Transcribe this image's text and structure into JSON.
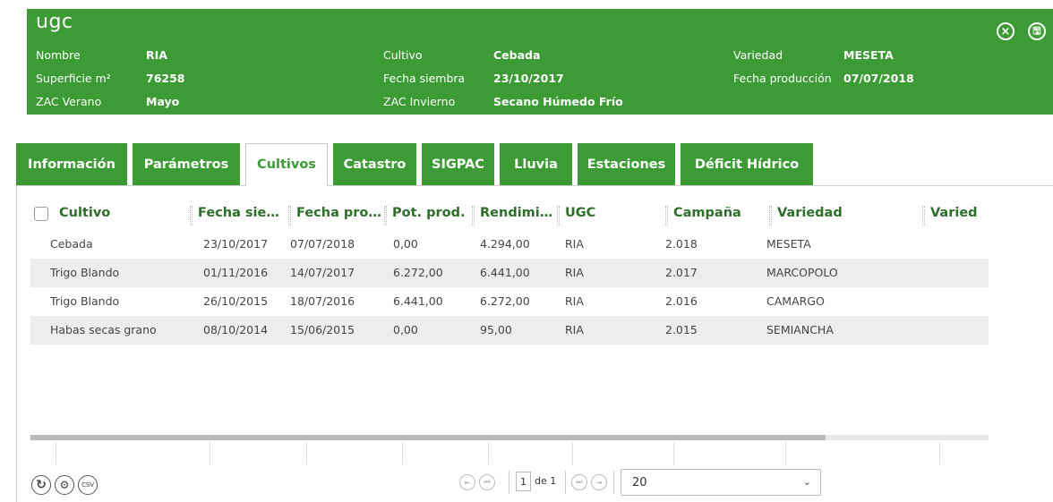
{
  "header": {
    "title": "ugc",
    "fields": [
      {
        "label": "Nombre",
        "value": "RIA"
      },
      {
        "label": "Superficie m²",
        "value": "76258"
      },
      {
        "label": "ZAC Verano",
        "value": "Mayo"
      },
      {
        "label": "Cultivo",
        "value": "Cebada"
      },
      {
        "label": "Fecha siembra",
        "value": "23/10/2017"
      },
      {
        "label": "ZAC Invierno",
        "value": "Secano Húmedo Frío"
      },
      {
        "label": "Variedad",
        "value": "MESETA"
      },
      {
        "label": "Fecha producción",
        "value": "07/07/2018"
      }
    ],
    "close_icon": "×",
    "save_icon": "🖫"
  },
  "tabs": [
    {
      "label": "Información"
    },
    {
      "label": "Parámetros"
    },
    {
      "label": "Cultivos",
      "active": true
    },
    {
      "label": "Catastro"
    },
    {
      "label": "SIGPAC"
    },
    {
      "label": "Lluvia"
    },
    {
      "label": "Estaciones"
    },
    {
      "label": "Déficit Hídrico"
    }
  ],
  "grid": {
    "columns": [
      "Cultivo",
      "Fecha sie…",
      "Fecha pro…",
      "Pot. prod.",
      "Rendimi…",
      "UGC",
      "Campaña",
      "Variedad",
      "Varied"
    ],
    "rows": [
      [
        "Cebada",
        "23/10/2017",
        "07/07/2018",
        "0,00",
        "4.294,00",
        "RIA",
        "2.018",
        "MESETA"
      ],
      [
        "Trigo Blando",
        "01/11/2016",
        "14/07/2017",
        "6.272,00",
        "6.441,00",
        "RIA",
        "2.017",
        "MARCOPOLO"
      ],
      [
        "Trigo Blando",
        "26/10/2015",
        "18/07/2016",
        "6.441,00",
        "6.272,00",
        "RIA",
        "2.016",
        "CAMARGO"
      ],
      [
        "Habas secas grano",
        "08/10/2014",
        "15/06/2015",
        "0,00",
        "95,00",
        "RIA",
        "2.015",
        "SEMIANCHA"
      ]
    ]
  },
  "footer": {
    "refresh_icon": "↻",
    "settings_icon": "⚙",
    "csv_label": "CSV",
    "page_value": "1",
    "of_text": "de 1",
    "page_size": "20",
    "pager_icons": [
      "⇤",
      "⏮",
      "⏭",
      "⇥"
    ]
  },
  "colors": {
    "accent": "#3d9b35",
    "header_text": "#2f6e2a"
  }
}
